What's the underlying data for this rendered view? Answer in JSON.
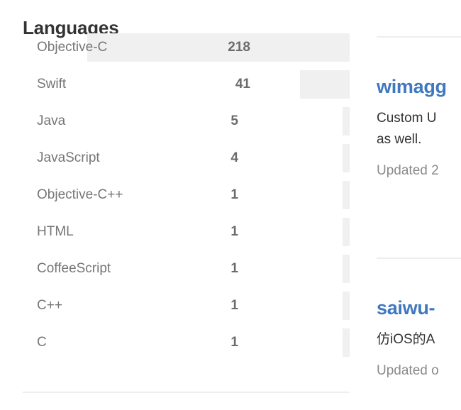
{
  "languages_panel": {
    "title": "Languages",
    "max_value": 218,
    "rows": [
      {
        "name": "Objective-C",
        "count": "218",
        "value": 218
      },
      {
        "name": "Swift",
        "count": "41",
        "value": 41
      },
      {
        "name": "Java",
        "count": "5",
        "value": 5
      },
      {
        "name": "JavaScript",
        "count": "4",
        "value": 4
      },
      {
        "name": "Objective-C++",
        "count": "1",
        "value": 1
      },
      {
        "name": "HTML",
        "count": "1",
        "value": 1
      },
      {
        "name": "CoffeeScript",
        "count": "1",
        "value": 1
      },
      {
        "name": "C++",
        "count": "1",
        "value": 1
      },
      {
        "name": "C",
        "count": "1",
        "value": 1
      }
    ]
  },
  "repositories_panel": {
    "items": [
      {
        "name": "wimagg",
        "description_line1": "Custom U",
        "description_line2": "as well.",
        "updated": "Updated 2"
      },
      {
        "name": "saiwu-",
        "description_line1": "仿iOS的A",
        "description_line2": "",
        "updated": "Updated o"
      }
    ]
  },
  "colors": {
    "bar": "#f0f0f0",
    "language_label": "#767676",
    "language_count": "#6b6b6b",
    "heading": "#333333",
    "link": "#4078c0",
    "muted_text": "#8a8a8a",
    "divider": "#eeeeee"
  }
}
